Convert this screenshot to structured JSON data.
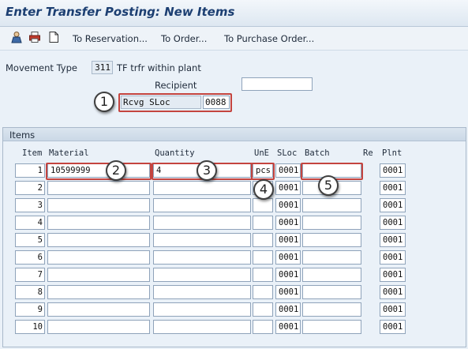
{
  "title": "Enter Transfer Posting: New Items",
  "toolbar": {
    "icons": [
      "person-icon",
      "printer-icon",
      "document-icon"
    ],
    "links": [
      "To Reservation...",
      "To Order...",
      "To Purchase Order..."
    ]
  },
  "header": {
    "movement_type_label": "Movement Type",
    "movement_type_code": "311",
    "movement_type_text": "TF trfr within plant",
    "recipient_label": "Recipient",
    "recipient_value": "",
    "rcvg_sloc_label": "Rcvg SLoc",
    "rcvg_sloc_value": "0088"
  },
  "items": {
    "title": "Items",
    "columns": [
      "Item",
      "Material",
      "Quantity",
      "UnE",
      "SLoc",
      "Batch",
      "Re",
      "Plnt"
    ],
    "rows": [
      {
        "item": "1",
        "material": "10599999",
        "quantity": "4",
        "une": "pcs",
        "sloc": "0001",
        "batch": "",
        "plnt": "0001"
      },
      {
        "item": "2",
        "material": "",
        "quantity": "",
        "une": "",
        "sloc": "0001",
        "batch": "",
        "plnt": "0001"
      },
      {
        "item": "3",
        "material": "",
        "quantity": "",
        "une": "",
        "sloc": "0001",
        "batch": "",
        "plnt": "0001"
      },
      {
        "item": "4",
        "material": "",
        "quantity": "",
        "une": "",
        "sloc": "0001",
        "batch": "",
        "plnt": "0001"
      },
      {
        "item": "5",
        "material": "",
        "quantity": "",
        "une": "",
        "sloc": "0001",
        "batch": "",
        "plnt": "0001"
      },
      {
        "item": "6",
        "material": "",
        "quantity": "",
        "une": "",
        "sloc": "0001",
        "batch": "",
        "plnt": "0001"
      },
      {
        "item": "7",
        "material": "",
        "quantity": "",
        "une": "",
        "sloc": "0001",
        "batch": "",
        "plnt": "0001"
      },
      {
        "item": "8",
        "material": "",
        "quantity": "",
        "une": "",
        "sloc": "0001",
        "batch": "",
        "plnt": "0001"
      },
      {
        "item": "9",
        "material": "",
        "quantity": "",
        "une": "",
        "sloc": "0001",
        "batch": "",
        "plnt": "0001"
      },
      {
        "item": "10",
        "material": "",
        "quantity": "",
        "une": "",
        "sloc": "0001",
        "batch": "",
        "plnt": "0001"
      }
    ]
  },
  "callouts": [
    "1",
    "2",
    "3",
    "4",
    "5"
  ],
  "colors": {
    "annotation_box": "#c4443f",
    "title_text": "#1c3f72"
  }
}
